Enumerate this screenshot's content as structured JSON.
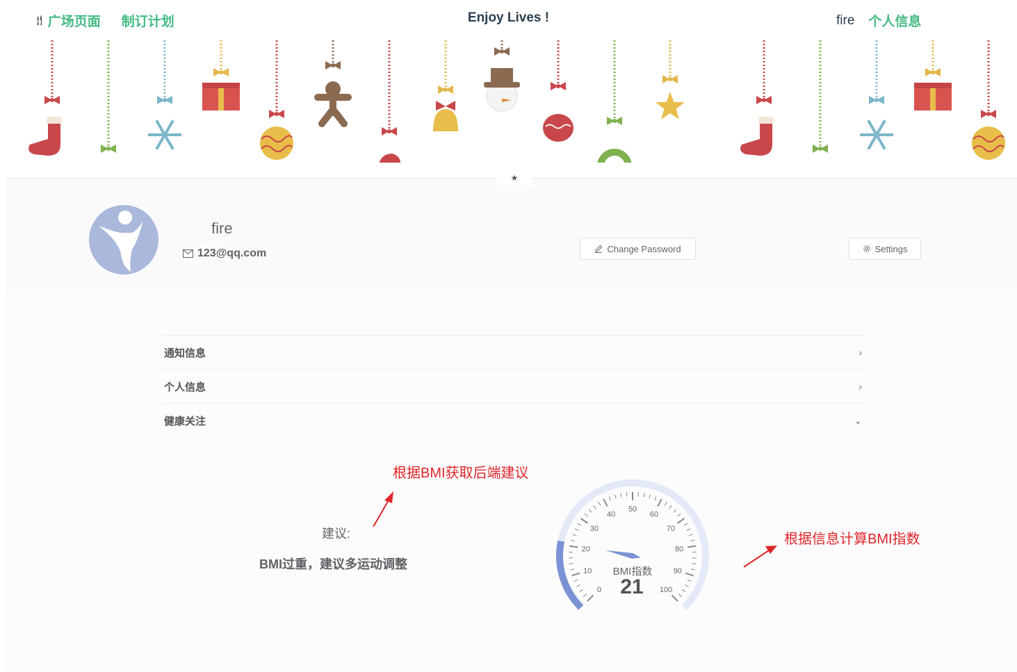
{
  "header": {
    "nav_left": [
      {
        "label": "广场页面",
        "icon": "fork-knife-icon"
      },
      {
        "label": "制订计划"
      }
    ],
    "title": "Enjoy Lives !",
    "user": "fire",
    "profile_link": "个人信息",
    "accent_color": "#42b983"
  },
  "profile": {
    "name": "fire",
    "email": "123@qq.com",
    "change_password_label": "Change Password",
    "settings_label": "Settings"
  },
  "sections": [
    {
      "title": "通知信息",
      "expanded": false
    },
    {
      "title": "个人信息",
      "expanded": false
    },
    {
      "title": "健康关注",
      "expanded": true
    }
  ],
  "health": {
    "suggest_label": "建议:",
    "suggestion": "BMI过重，建议多运动调整",
    "gauge_title": "BMI指数",
    "gauge_value": 21,
    "gauge_min": 0,
    "gauge_max": 100,
    "gauge_ticks": [
      "0",
      "10",
      "20",
      "30",
      "40",
      "50",
      "60",
      "70",
      "80",
      "90",
      "100"
    ]
  },
  "annotations": {
    "a1": "根据BMI获取后端建议",
    "a2": "根据信息计算BMI指数"
  }
}
